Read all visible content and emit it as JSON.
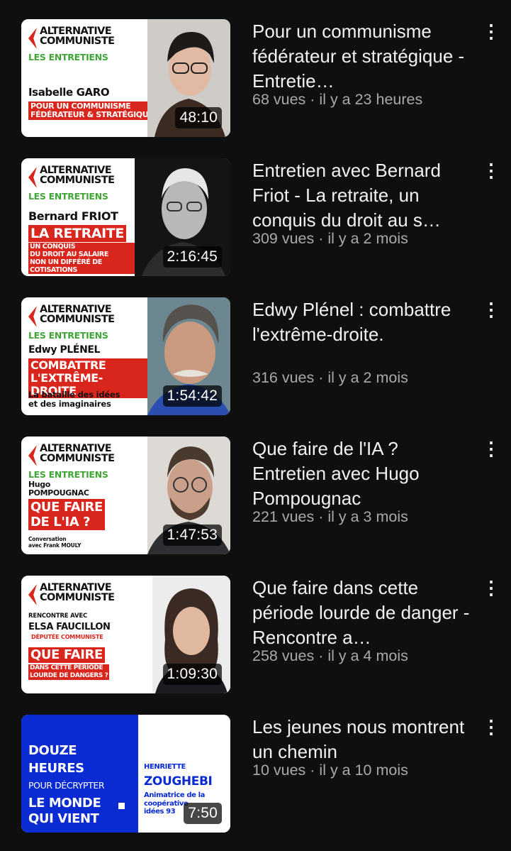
{
  "videos": [
    {
      "title": "Pour un communisme fédérateur et stratégique - Entretie…",
      "views": "68 vues",
      "age": "il y a 23 heures",
      "duration": "48:10",
      "thumb": {
        "logo": "ALTERNATIVE\nCOMMUNISTE",
        "series": "LES ENTRETIENS",
        "guest": "Isabelle GARO",
        "headline": "POUR UN COMMUNISME\nFÉDÉRATEUR & STRATÉGIQUE"
      }
    },
    {
      "title": "Entretien avec Bernard Friot - La retraite, un conquis du droit au s…",
      "views": "309 vues",
      "age": "il y a 2 mois",
      "duration": "2:16:45",
      "thumb": {
        "logo": "ALTERNATIVE\nCOMMUNISTE",
        "series": "LES ENTRETIENS",
        "guest": "Bernard FRIOT",
        "headline": "LA RETRAITE",
        "subline": "UN CONQUIS\nDU DROIT AU SALAIRE\nNON UN DIFFÉRÉ DE COTISATIONS"
      }
    },
    {
      "title": "Edwy Plénel : combattre l'extrême-droite.",
      "views": "316 vues",
      "age": "il y a 2 mois",
      "duration": "1:54:42",
      "thumb": {
        "logo": "ALTERNATIVE\nCOMMUNISTE",
        "series": "LES ENTRETIENS",
        "guest": "Edwy PLÉNEL",
        "headline": "COMBATTRE\nL'EXTRÊME-DROITE",
        "caption": "La bataille des idées\net des imaginaires"
      }
    },
    {
      "title": "Que faire de l'IA ? Entretien avec Hugo Pompougnac",
      "views": "221 vues",
      "age": "il y a 3 mois",
      "duration": "1:47:53",
      "thumb": {
        "logo": "ALTERNATIVE\nCOMMUNISTE",
        "series": "LES ENTRETIENS",
        "guest": "Hugo\nPOMPOUGNAC",
        "headline": "QUE FAIRE\nDE L'IA ?",
        "caption": "Conversation\navec Frank MOULY"
      }
    },
    {
      "title": "Que faire dans cette période lourde de danger - Rencontre a…",
      "views": "258 vues",
      "age": "il y a 4 mois",
      "duration": "1:09:30",
      "thumb": {
        "logo": "ALTERNATIVE\nCOMMUNISTE",
        "intro": "RENCONTRE AVEC",
        "guest": "ELSA FAUCILLON",
        "role": "DÉPUTÉE COMMUNISTE",
        "headline": "QUE FAIRE",
        "subline": "DANS CETTE PÉRIODE\nLOURDE DE DANGERS ?"
      }
    },
    {
      "title": "Les jeunes nous montrent un chemin",
      "views": "10 vues",
      "age": "il y a 10 mois",
      "duration": "7:50",
      "thumb": {
        "blue_text_1": "DOUZE\nHEURES",
        "blue_text_2": "POUR DÉCRYPTER",
        "blue_text_3": "LE MONDE\nQUI VIENT",
        "name_1": "HENRIETTE",
        "name_2": "ZOUGHEBI",
        "role": "Animatrice de la\ncoopérative\nidées 93"
      }
    }
  ],
  "separator": " · ",
  "menu_glyph": "⋮",
  "colors": {
    "background": "#0f0f0f",
    "title": "#f1f1f1",
    "meta": "#a9a9a9",
    "red": "#d9261c",
    "green": "#3fa535",
    "blue": "#0a2bd1"
  }
}
